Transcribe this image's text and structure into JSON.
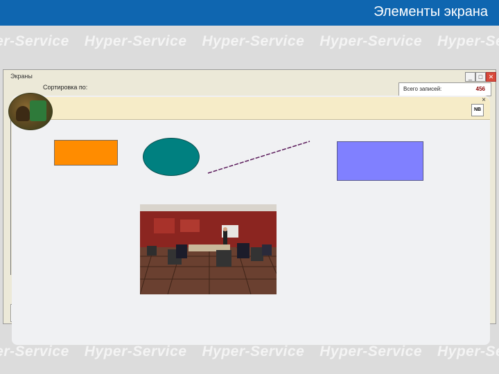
{
  "header": {
    "title": "Элементы экрана"
  },
  "watermark": {
    "text": "Hyper-Service"
  },
  "window": {
    "title": "Экраны",
    "buttons": {
      "minimize": "_",
      "maximize": "□",
      "close": "✕"
    },
    "sort_label": "Сортировка по:",
    "records": {
      "label": "Всего записей:",
      "value": "456"
    }
  },
  "toolbar": {
    "close": "×",
    "nb_label": "NB"
  },
  "colors": {
    "header_bg": "#0f66b0",
    "toolbar_bg": "#f6ecc8",
    "rectangle_orange": "#ff8c00",
    "ellipse_teal": "#008080",
    "rectangle_blue": "#8080ff",
    "line": "#5a1a5a"
  }
}
